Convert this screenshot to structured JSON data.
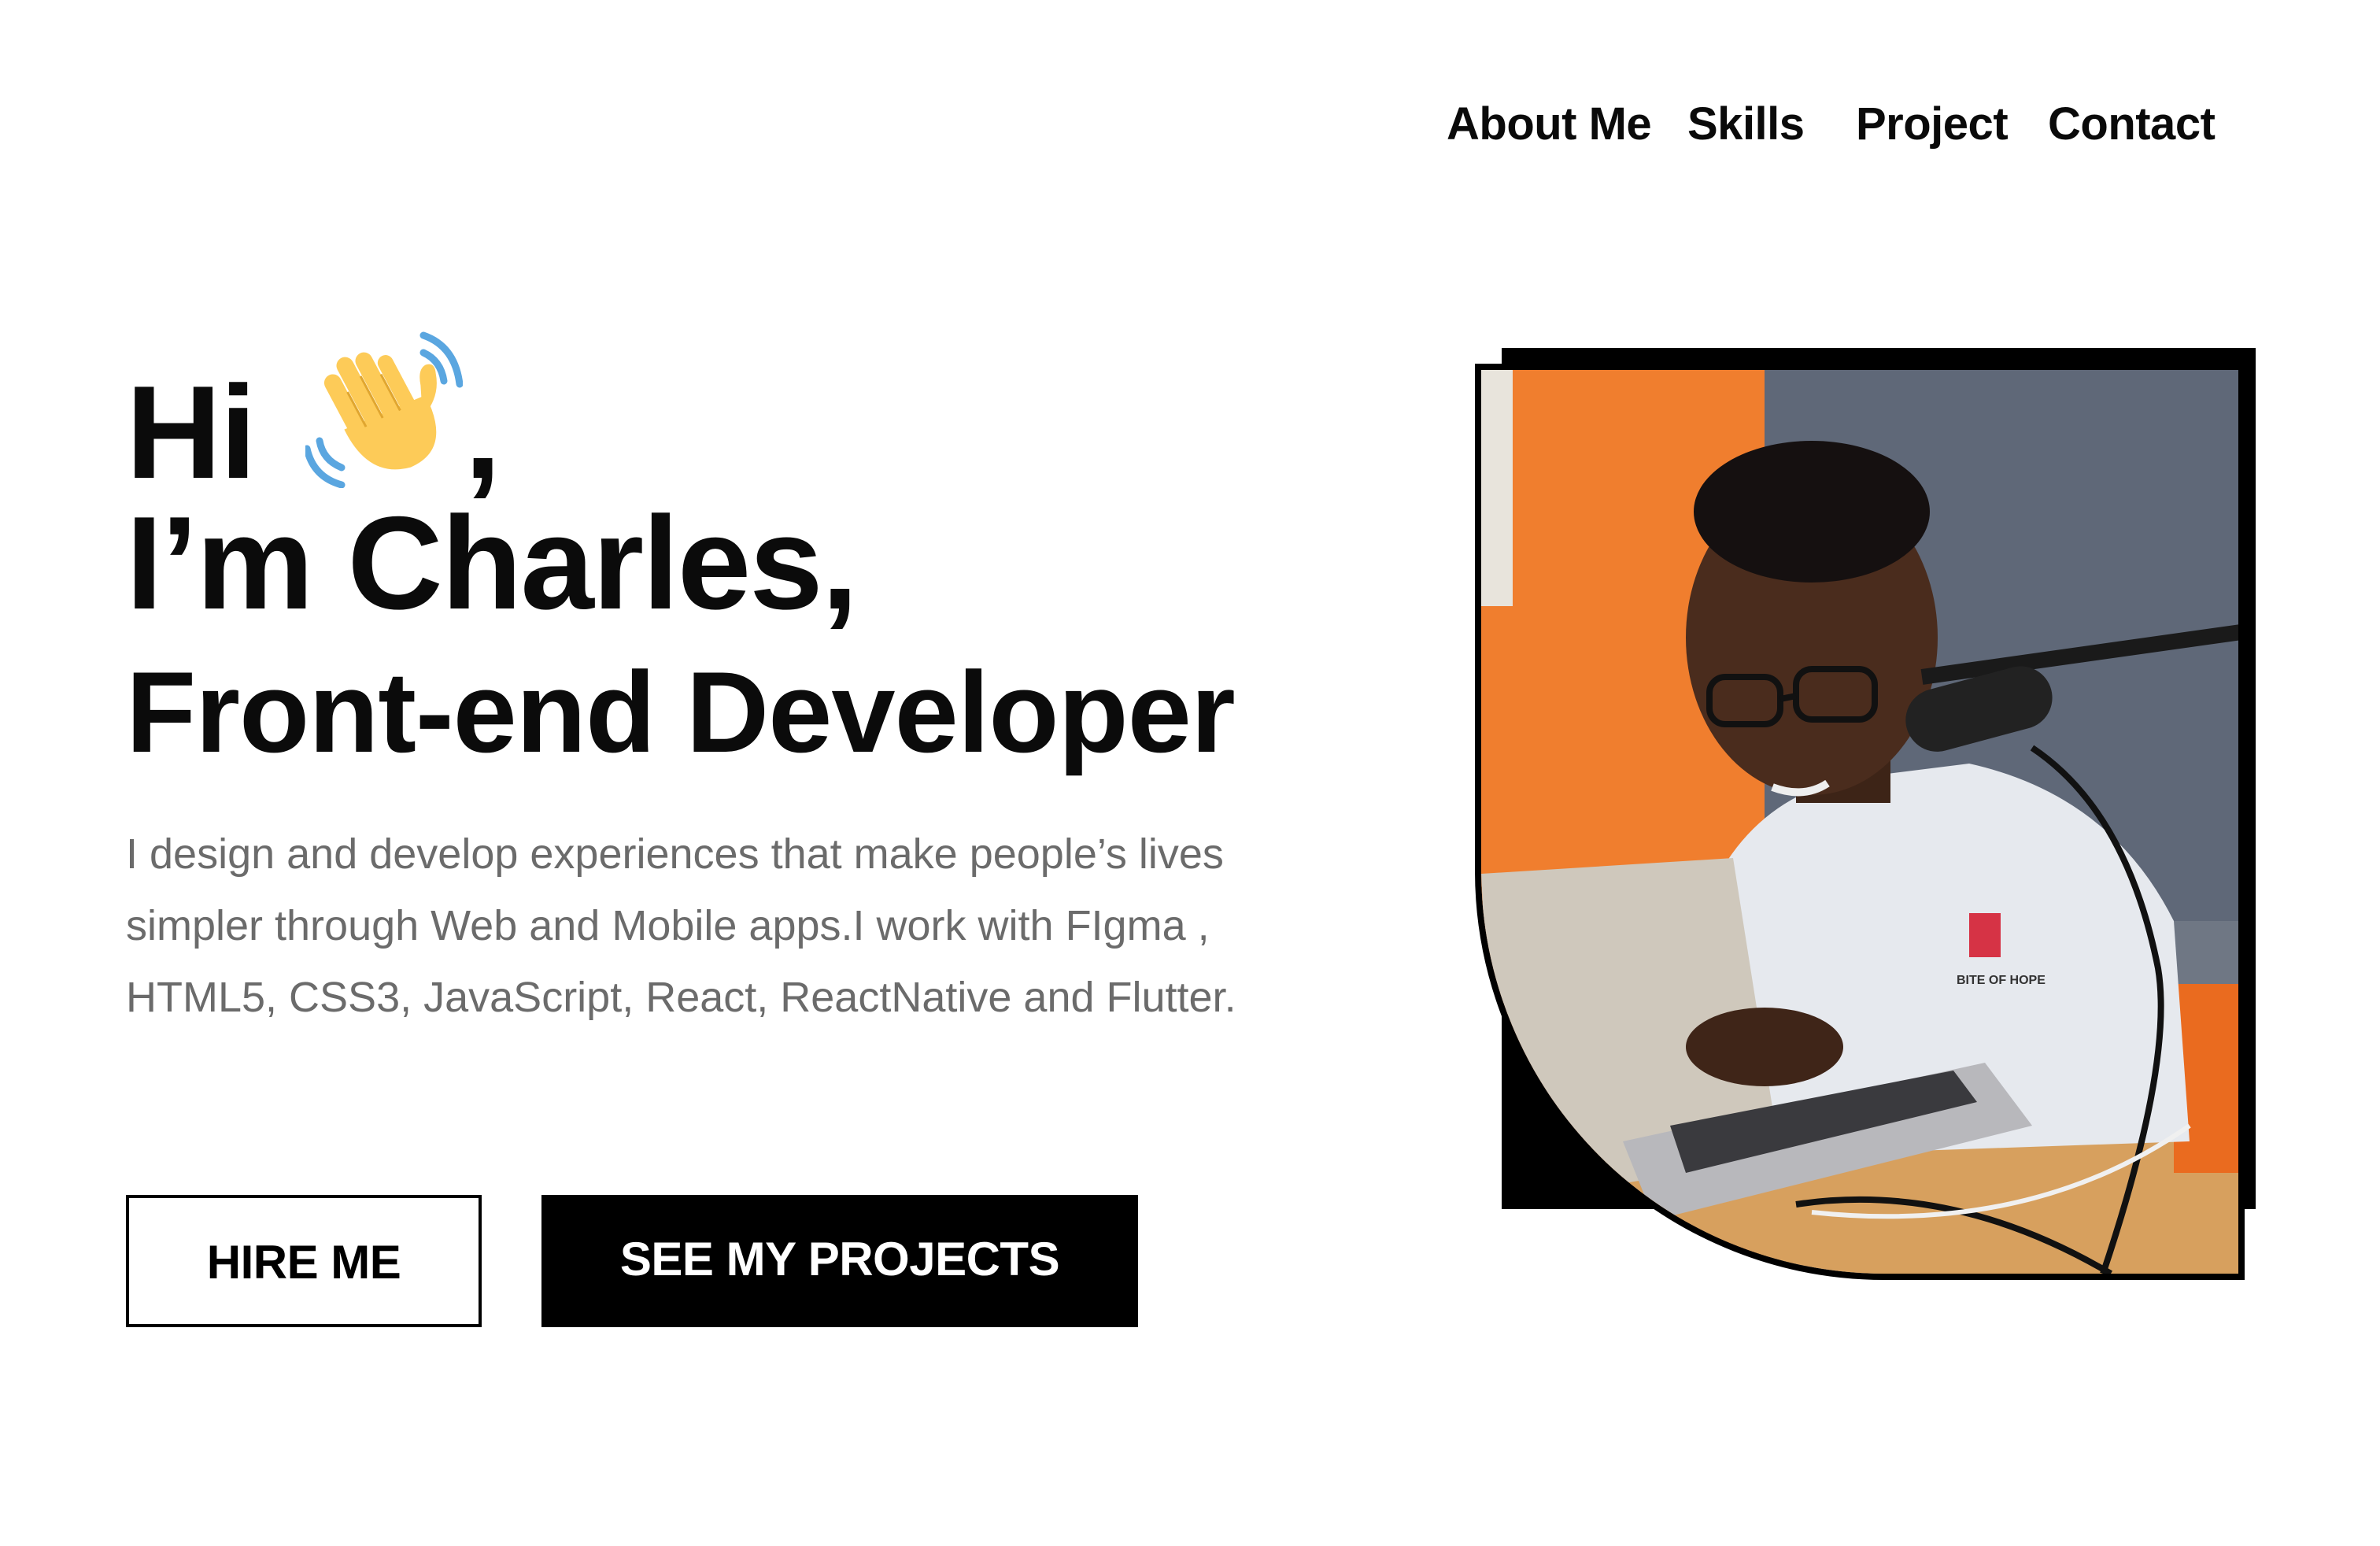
{
  "nav": {
    "items": [
      {
        "label": "About Me"
      },
      {
        "label": "Skills"
      },
      {
        "label": "Project"
      },
      {
        "label": "Contact"
      }
    ]
  },
  "hero": {
    "greeting": "Hi",
    "greeting_emoji": "waving-hand-icon",
    "greeting_suffix": ",",
    "name_line": "I’m Charles,",
    "role_line": "Front-end Developer",
    "description": "I design and develop experiences that make people’s lives simpler through Web and Mobile apps.I work with FIgma , HTML5, CSS3, JavaScript, React, ReactNative and Flutter."
  },
  "buttons": {
    "hire_label": "HIRE ME",
    "projects_label": "SEE MY PROJECTS"
  },
  "photo": {
    "shirt_text": "BITE OF HOPE"
  },
  "colors": {
    "text_primary": "#0b0b0b",
    "text_muted": "#6b6b6b",
    "button_dark": "#000000",
    "background": "#ffffff"
  }
}
